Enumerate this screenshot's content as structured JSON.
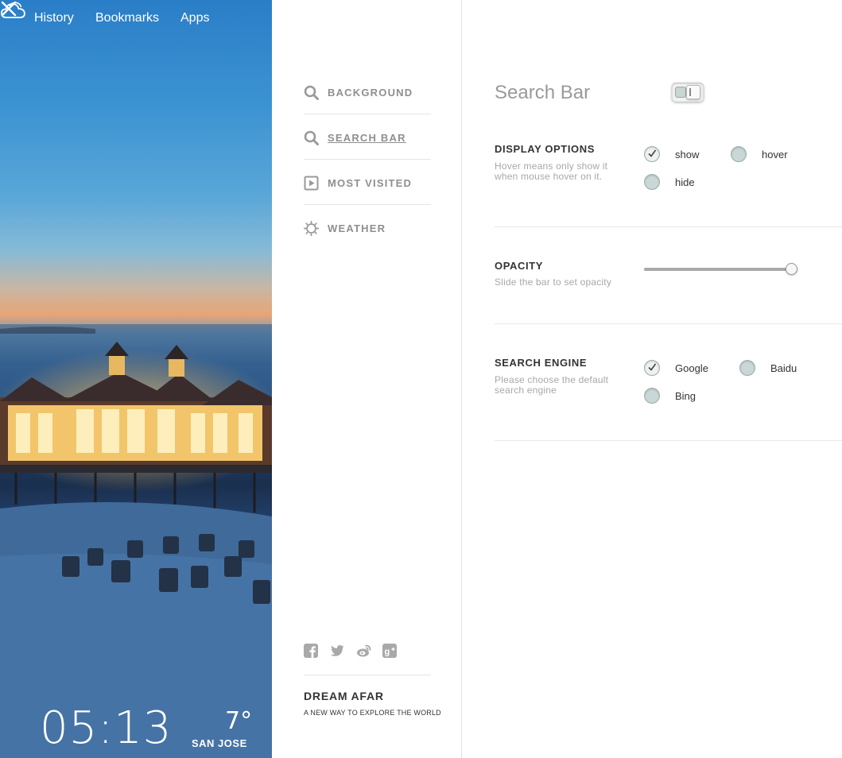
{
  "top_nav": {
    "history": "History",
    "bookmarks": "Bookmarks",
    "apps": "Apps",
    "close_icon": "close-icon"
  },
  "clock": {
    "time": "05:13"
  },
  "weather": {
    "temperature": "7°",
    "city": "SAN JOSE",
    "icon": "cloud-icon"
  },
  "menu": {
    "items": [
      {
        "label": "BACKGROUND",
        "icon": "search-icon",
        "active": false
      },
      {
        "label": "SEARCH BAR",
        "icon": "search-icon",
        "active": true
      },
      {
        "label": "MOST VISITED",
        "icon": "play-icon",
        "active": false
      },
      {
        "label": "WEATHER",
        "icon": "sun-icon",
        "active": false
      }
    ],
    "socials": [
      "facebook-icon",
      "twitter-icon",
      "weibo-icon",
      "google-plus-icon"
    ],
    "brand": {
      "name": "DREAM AFAR",
      "tagline": "A NEW WAY TO EXPLORE THE WORLD"
    }
  },
  "settings": {
    "title": "Search Bar",
    "enabled": true,
    "display_options": {
      "title": "DISPLAY OPTIONS",
      "description": "Hover means only show it when mouse hover on it.",
      "options": [
        {
          "label": "show",
          "checked": true
        },
        {
          "label": "hover",
          "checked": false
        },
        {
          "label": "hide",
          "checked": false
        }
      ]
    },
    "opacity": {
      "title": "OPACITY",
      "description": "Slide the bar to set opacity",
      "value": 1.0
    },
    "search_engine": {
      "title": "SEARCH ENGINE",
      "description": "Please choose the default search engine",
      "options": [
        {
          "label": "Google",
          "checked": true
        },
        {
          "label": "Baidu",
          "checked": false
        },
        {
          "label": "Bing",
          "checked": false
        }
      ]
    }
  },
  "colors": {
    "menu_text": "#8f8f8f",
    "title_gray": "#9a9a9a",
    "radio_fill": "#c9d8d6"
  }
}
